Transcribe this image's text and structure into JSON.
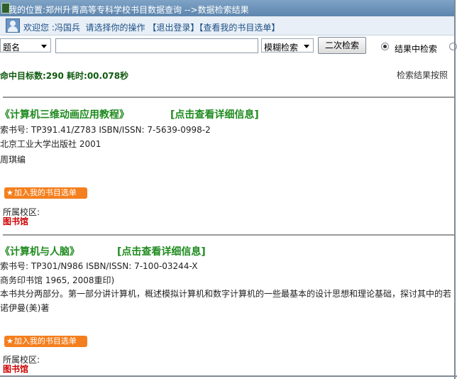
{
  "titlebar": {
    "text": "我的位置:郑州升青高等专科学校书目数据查询 -->数据检索结果"
  },
  "welcome": {
    "prefix": "欢迎您 :",
    "user": "冯国兵",
    "instruction": "请选择你的操作",
    "logout": "【退出登录】",
    "view_list": "【查看我的书目选单】"
  },
  "search": {
    "field_select": "题名",
    "input_value": "",
    "mode_select": "模糊检索",
    "secondary_button": "二次检索",
    "radio_in_results": "结果中检索"
  },
  "summary": {
    "stats": "命中目标数:290 耗时:00.078秒",
    "sort_label": "检索结果按照"
  },
  "records": [
    {
      "title": "《计算机三维动画应用教程》",
      "detail_link": "[点击查看详细信息]",
      "call_no": "索书号: TP391.41/Z783     ISBN/ISSN: 7-5639-0998-2",
      "publisher": "北京工业大学出版社    2001",
      "author": "周琪编",
      "add_button": "加入我的书目选单",
      "campus_label": "所属校区:",
      "campus": "图书馆"
    },
    {
      "title": "《计算机与人脑》",
      "detail_link": "[点击查看详细信息]",
      "call_no": "索书号: TP301/N986     ISBN/ISSN: 7-100-03244-X",
      "publisher": "商务印书馆    1965, 2008重印)",
      "summary": "本书共分两部分。第一部分讲计算机，概述模拟计算机和数字计算机的一些最基本的设计思想和理论基础，探讨其中的若",
      "author": "诺伊曼(美)著",
      "add_button": "加入我的书目选单",
      "campus_label": "所属校区:",
      "campus": "图书馆"
    }
  ]
}
